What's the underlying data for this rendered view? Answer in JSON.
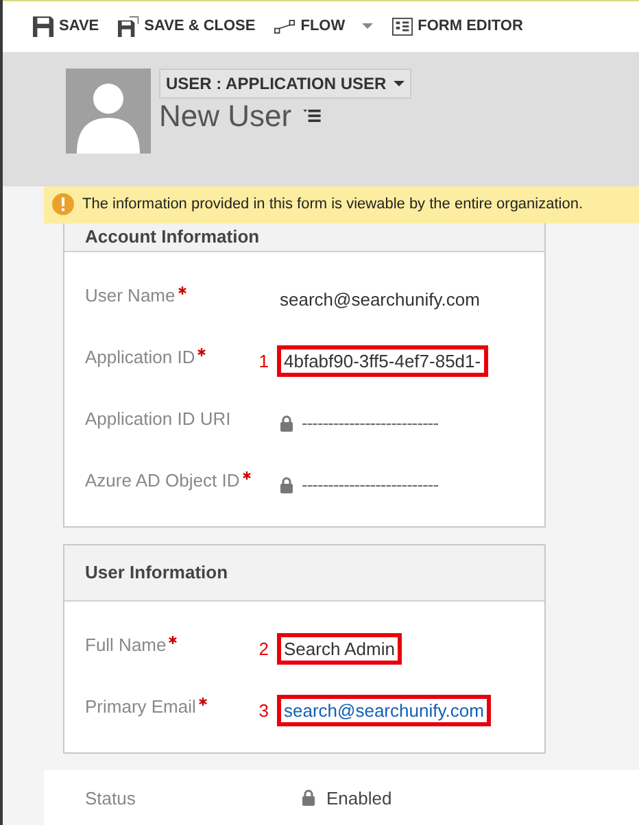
{
  "toolbar": [
    {
      "kind": "save",
      "label": "SAVE"
    },
    {
      "kind": "save-close",
      "label": "SAVE & CLOSE"
    },
    {
      "kind": "flow",
      "label": "FLOW",
      "dropdown": true
    },
    {
      "kind": "form-editor",
      "label": "FORM EDITOR"
    }
  ],
  "header": {
    "form_selector": "USER : APPLICATION USER",
    "title": "New User"
  },
  "notification": {
    "text": "The information provided in this form is viewable by the entire organization."
  },
  "sections": [
    {
      "title": "Account Information",
      "fields": [
        {
          "label": "User Name",
          "required": true,
          "kind": "text",
          "value": "search@searchunify.com"
        },
        {
          "label": "Application ID",
          "required": true,
          "kind": "text",
          "value": "4bfabf90-3ff5-4ef7-85d1-",
          "annotation": "1"
        },
        {
          "label": "Application ID URI",
          "required": false,
          "kind": "locked",
          "value": "--------------------------"
        },
        {
          "label": "Azure AD Object ID",
          "required": true,
          "kind": "locked",
          "value": "--------------------------"
        }
      ]
    },
    {
      "title": "User Information",
      "fields": [
        {
          "label": "Full Name",
          "required": true,
          "kind": "text",
          "value": "Search Admin",
          "annotation": "2"
        },
        {
          "label": "Primary Email",
          "required": true,
          "kind": "link",
          "value": "search@searchunify.com",
          "annotation": "3"
        }
      ]
    }
  ],
  "footer": {
    "label": "Status",
    "value": "Enabled",
    "locked": true
  }
}
